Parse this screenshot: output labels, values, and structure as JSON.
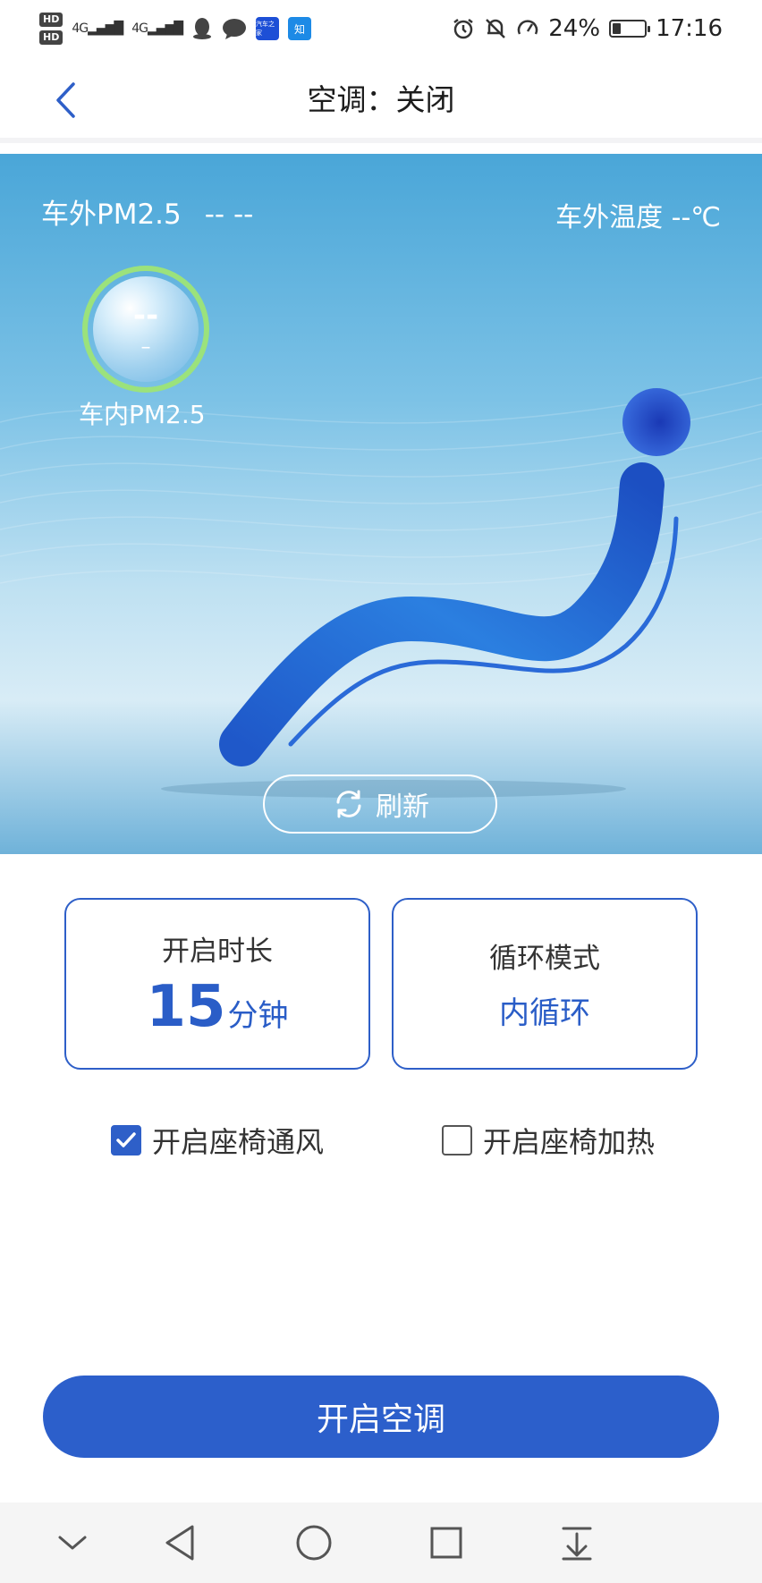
{
  "status_bar": {
    "hd1": "HD",
    "hd2": "HD",
    "net1": "4G",
    "net2": "4G",
    "app1": "汽车之家",
    "app2": "知",
    "battery": "24%",
    "time": "17:16"
  },
  "header": {
    "title": "空调：关闭"
  },
  "hero": {
    "pm_outside_label": "车外PM2.5",
    "pm_outside_value": "-- --",
    "temp_outside": "车外温度 --℃",
    "pm_inside_value": "--",
    "pm_inside_sub": "–",
    "pm_inside_label": "车内PM2.5",
    "refresh_label": "刷新"
  },
  "options": {
    "duration_label": "开启时长",
    "duration_value": "15",
    "duration_unit": "分钟",
    "mode_label": "循环模式",
    "mode_value": "内循环"
  },
  "checks": {
    "ventilation_label": "开启座椅通风",
    "ventilation_checked": true,
    "heating_label": "开启座椅加热",
    "heating_checked": false
  },
  "primary_button": "开启空调",
  "colors": {
    "accent": "#2c5fcb",
    "pm_ring": "#9be27c",
    "hero_top": "#4aa6d8"
  }
}
